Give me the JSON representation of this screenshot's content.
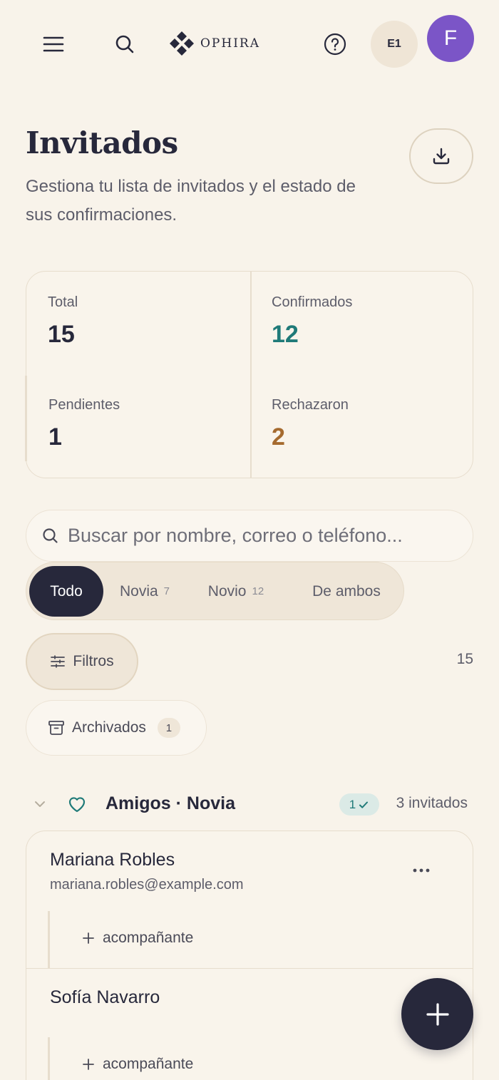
{
  "header": {
    "brand": "OPHIRA",
    "event_badge": "E1",
    "avatar_initial": "F"
  },
  "page": {
    "title": "Invitados",
    "subtitle": "Gestiona tu lista de invitados y el estado de sus confirmaciones."
  },
  "stats": {
    "total": {
      "label": "Total",
      "value": "15"
    },
    "confirmed": {
      "label": "Confirmados",
      "value": "12"
    },
    "pending": {
      "label": "Pendientes",
      "value": "1"
    },
    "rejected": {
      "label": "Rechazaron",
      "value": "2"
    }
  },
  "search": {
    "placeholder": "Buscar por nombre, correo o teléfono..."
  },
  "segments": [
    {
      "label": "Todo",
      "count": ""
    },
    {
      "label": "Novia",
      "count": "7"
    },
    {
      "label": "Novio",
      "count": "12"
    },
    {
      "label": "De ambos",
      "count": ""
    }
  ],
  "filters": {
    "label": "Filtros",
    "result_count": "15",
    "archived_label": "Archivados",
    "archived_count": "1"
  },
  "group": {
    "title": "Amigos · Novia",
    "confirmed_badge": "1",
    "guest_count": "3 invitados"
  },
  "guests": [
    {
      "name": "Mariana Robles",
      "email": "mariana.robles@example.com",
      "companion_label": "acompañante"
    },
    {
      "name": "Sofía Navarro",
      "email": "",
      "companion_label": "acompañante"
    }
  ],
  "colors": {
    "background": "#f8f3ea",
    "ink": "#27283b",
    "confirmed": "#1f7a78",
    "rejected": "#a56a2e",
    "avatar": "#7b55c7",
    "muted": "#5d5d6a"
  }
}
